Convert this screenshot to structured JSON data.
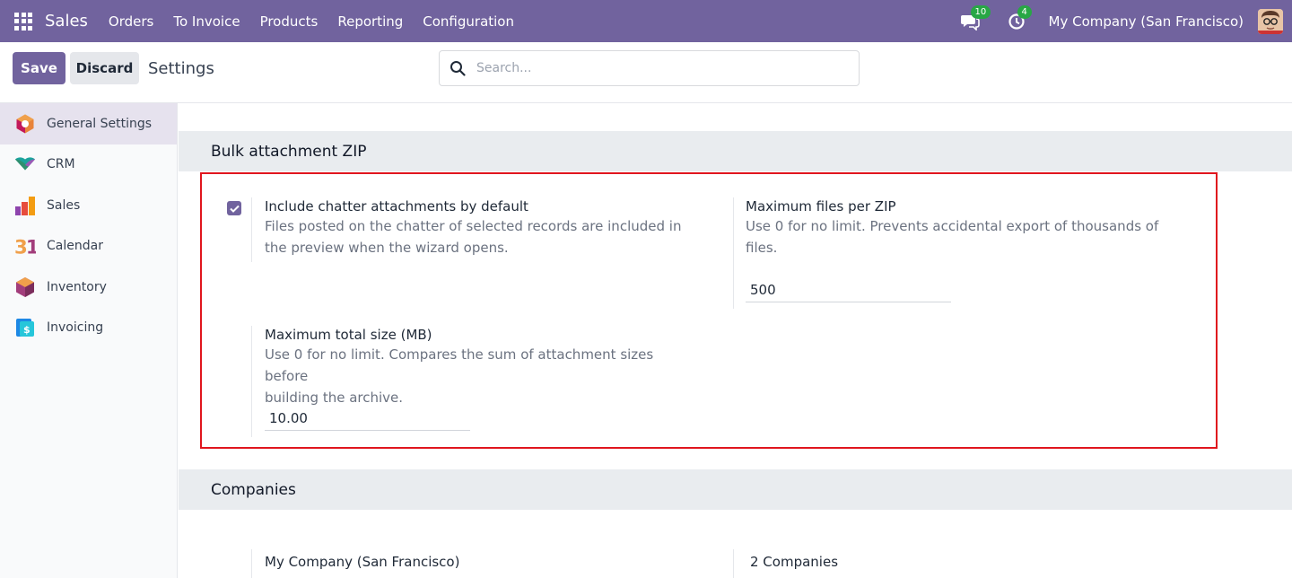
{
  "navbar": {
    "brand": "Sales",
    "menu": [
      "Orders",
      "To Invoice",
      "Products",
      "Reporting",
      "Configuration"
    ],
    "messages_count": "10",
    "activities_count": "4",
    "company": "My Company (San Francisco)",
    "icons": {
      "apps": "apps-grid-icon",
      "messages": "chat-icon",
      "activities": "clock-icon"
    }
  },
  "control_panel": {
    "save_label": "Save",
    "discard_label": "Discard",
    "title": "Settings",
    "search_placeholder": "Search..."
  },
  "sidebar": {
    "items": [
      {
        "label": "General Settings",
        "icon": "general-settings-icon",
        "active": true
      },
      {
        "label": "CRM",
        "icon": "crm-icon"
      },
      {
        "label": "Sales",
        "icon": "sales-icon"
      },
      {
        "label": "Calendar",
        "icon": "calendar-icon"
      },
      {
        "label": "Inventory",
        "icon": "inventory-icon"
      },
      {
        "label": "Invoicing",
        "icon": "invoicing-icon"
      }
    ]
  },
  "bulk_zip": {
    "header": "Bulk attachment ZIP",
    "include_chatter": {
      "title": "Include chatter attachments by default",
      "desc_line1": "Files posted on the chatter of selected records are included in",
      "desc_line2": "the preview when the wizard opens.",
      "checked": true
    },
    "max_files": {
      "title": "Maximum files per ZIP",
      "desc_line1": "Use 0 for no limit. Prevents accidental export of thousands of",
      "desc_line2": "files.",
      "value": "500"
    },
    "max_size": {
      "title": "Maximum total size (MB)",
      "desc_line1": "Use 0 for no limit. Compares the sum of attachment sizes before",
      "desc_line2": "building the archive.",
      "value": "10.00"
    }
  },
  "companies": {
    "header": "Companies",
    "current_company": "My Company (San Francisco)",
    "count_label": "2 Companies"
  },
  "colors": {
    "brand": "#71639e",
    "highlight": "#e0161e",
    "badge": "#28a745"
  }
}
